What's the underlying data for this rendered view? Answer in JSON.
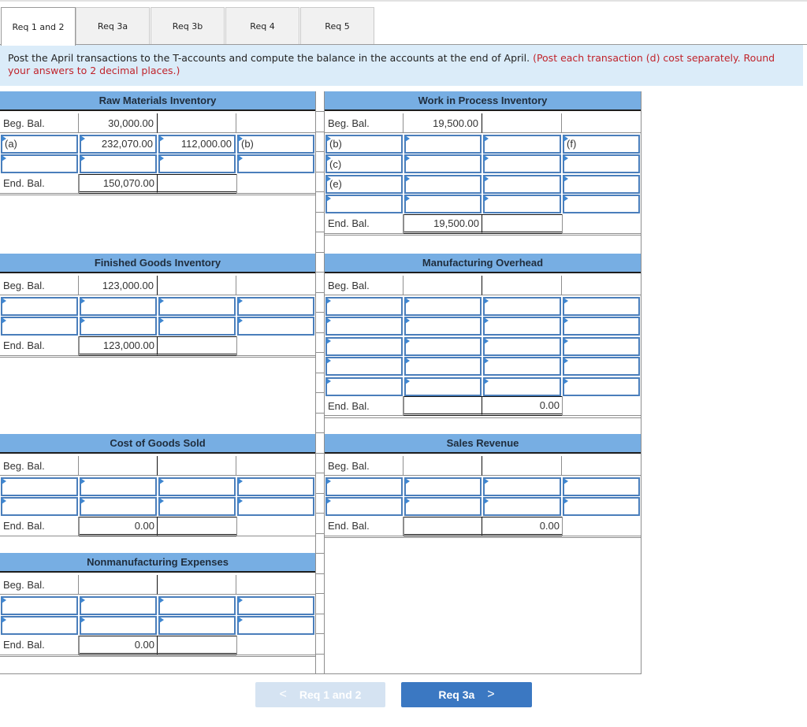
{
  "tabs": [
    {
      "label": "Req 1 and 2",
      "active": true
    },
    {
      "label": "Req 3a",
      "active": false
    },
    {
      "label": "Req 3b",
      "active": false
    },
    {
      "label": "Req 4",
      "active": false
    },
    {
      "label": "Req 5",
      "active": false
    }
  ],
  "instructions": {
    "main": "Post the April transactions to the T-accounts and compute the balance in the accounts at the end of April. ",
    "note": "(Post each transaction (d) cost separately. Round your answers to 2 decimal places.)"
  },
  "labels": {
    "beg_bal": "Beg. Bal.",
    "end_bal": "End. Bal."
  },
  "accounts": {
    "raw_materials": {
      "title": "Raw Materials Inventory",
      "beg_debit": "30,000.00",
      "rows": [
        {
          "debit_label": "(a)",
          "debit": "232,070.00",
          "credit": "112,000.00",
          "credit_label": "(b)"
        },
        {
          "debit_label": "",
          "debit": "",
          "credit": "",
          "credit_label": ""
        }
      ],
      "end_debit": "150,070.00",
      "end_credit": ""
    },
    "work_in_process": {
      "title": "Work in Process Inventory",
      "beg_debit": "19,500.00",
      "rows": [
        {
          "debit_label": "(b)",
          "debit": "",
          "credit": "",
          "credit_label": "(f)"
        },
        {
          "debit_label": "(c)",
          "debit": "",
          "credit": "",
          "credit_label": ""
        },
        {
          "debit_label": "(e)",
          "debit": "",
          "credit": "",
          "credit_label": ""
        },
        {
          "debit_label": "",
          "debit": "",
          "credit": "",
          "credit_label": ""
        }
      ],
      "end_debit": "19,500.00",
      "end_credit": ""
    },
    "finished_goods": {
      "title": "Finished Goods Inventory",
      "beg_debit": "123,000.00",
      "rows": [
        {
          "debit_label": "",
          "debit": "",
          "credit": "",
          "credit_label": ""
        },
        {
          "debit_label": "",
          "debit": "",
          "credit": "",
          "credit_label": ""
        }
      ],
      "end_debit": "123,000.00",
      "end_credit": ""
    },
    "manufacturing_overhead": {
      "title": "Manufacturing Overhead",
      "beg_debit": "",
      "rows": [
        {
          "debit_label": "",
          "debit": "",
          "credit": "",
          "credit_label": ""
        },
        {
          "debit_label": "",
          "debit": "",
          "credit": "",
          "credit_label": ""
        },
        {
          "debit_label": "",
          "debit": "",
          "credit": "",
          "credit_label": ""
        },
        {
          "debit_label": "",
          "debit": "",
          "credit": "",
          "credit_label": ""
        },
        {
          "debit_label": "",
          "debit": "",
          "credit": "",
          "credit_label": ""
        }
      ],
      "end_debit": "",
      "end_credit": "0.00"
    },
    "cost_of_goods_sold": {
      "title": "Cost of Goods Sold",
      "beg_debit": "",
      "rows": [
        {
          "debit_label": "",
          "debit": "",
          "credit": "",
          "credit_label": ""
        },
        {
          "debit_label": "",
          "debit": "",
          "credit": "",
          "credit_label": ""
        }
      ],
      "end_debit": "0.00",
      "end_credit": ""
    },
    "sales_revenue": {
      "title": "Sales Revenue",
      "beg_debit": "",
      "rows": [
        {
          "debit_label": "",
          "debit": "",
          "credit": "",
          "credit_label": ""
        },
        {
          "debit_label": "",
          "debit": "",
          "credit": "",
          "credit_label": ""
        }
      ],
      "end_debit": "",
      "end_credit": "0.00"
    },
    "nonmanufacturing_expenses": {
      "title": "Nonmanufacturing Expenses",
      "beg_debit": "",
      "rows": [
        {
          "debit_label": "",
          "debit": "",
          "credit": "",
          "credit_label": ""
        },
        {
          "debit_label": "",
          "debit": "",
          "credit": "",
          "credit_label": ""
        }
      ],
      "end_debit": "0.00",
      "end_credit": ""
    }
  },
  "nav": {
    "prev_label": "Req 1 and 2",
    "next_label": "Req 3a",
    "prev_icon": "chevron-left-icon",
    "next_icon": "chevron-right-icon",
    "prev_glyph": "<",
    "next_glyph": ">"
  }
}
